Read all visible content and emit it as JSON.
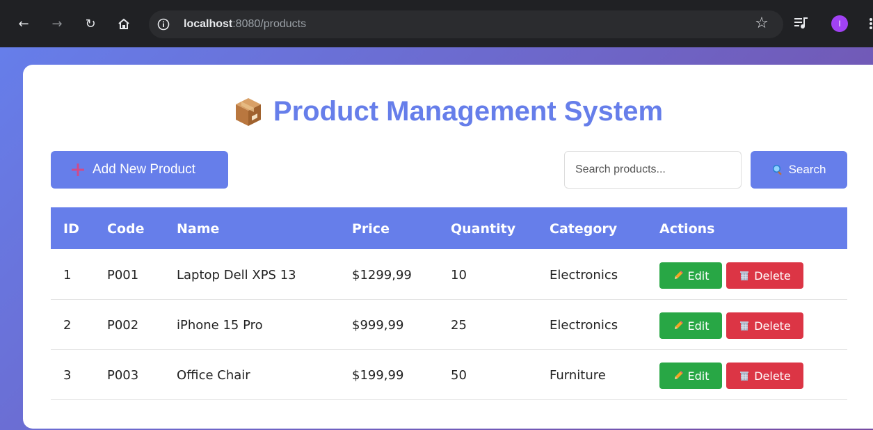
{
  "browser": {
    "url_host": "localhost",
    "url_path": ":8080/products",
    "profile_initial": "I"
  },
  "colors": {
    "primary": "#667eea",
    "gradient_end": "#764ba2",
    "edit": "#28a745",
    "delete": "#dc3545"
  },
  "header": {
    "title": "Product Management System",
    "title_icon": "package-box-icon"
  },
  "toolbar": {
    "add_label": "Add New Product",
    "add_icon": "plus-icon",
    "search_placeholder": "Search products...",
    "search_value": "",
    "search_label": "Search",
    "search_icon": "magnifier-icon"
  },
  "table": {
    "columns": [
      "ID",
      "Code",
      "Name",
      "Price",
      "Quantity",
      "Category",
      "Actions"
    ],
    "rows": [
      {
        "id": "1",
        "code": "P001",
        "name": "Laptop Dell XPS 13",
        "price": "$1299,99",
        "quantity": "10",
        "category": "Electronics"
      },
      {
        "id": "2",
        "code": "P002",
        "name": "iPhone 15 Pro",
        "price": "$999,99",
        "quantity": "25",
        "category": "Electronics"
      },
      {
        "id": "3",
        "code": "P003",
        "name": "Office Chair",
        "price": "$199,99",
        "quantity": "50",
        "category": "Furniture"
      }
    ],
    "edit_label": "Edit",
    "delete_label": "Delete",
    "edit_icon": "pencil-icon",
    "delete_icon": "wastebasket-icon"
  }
}
